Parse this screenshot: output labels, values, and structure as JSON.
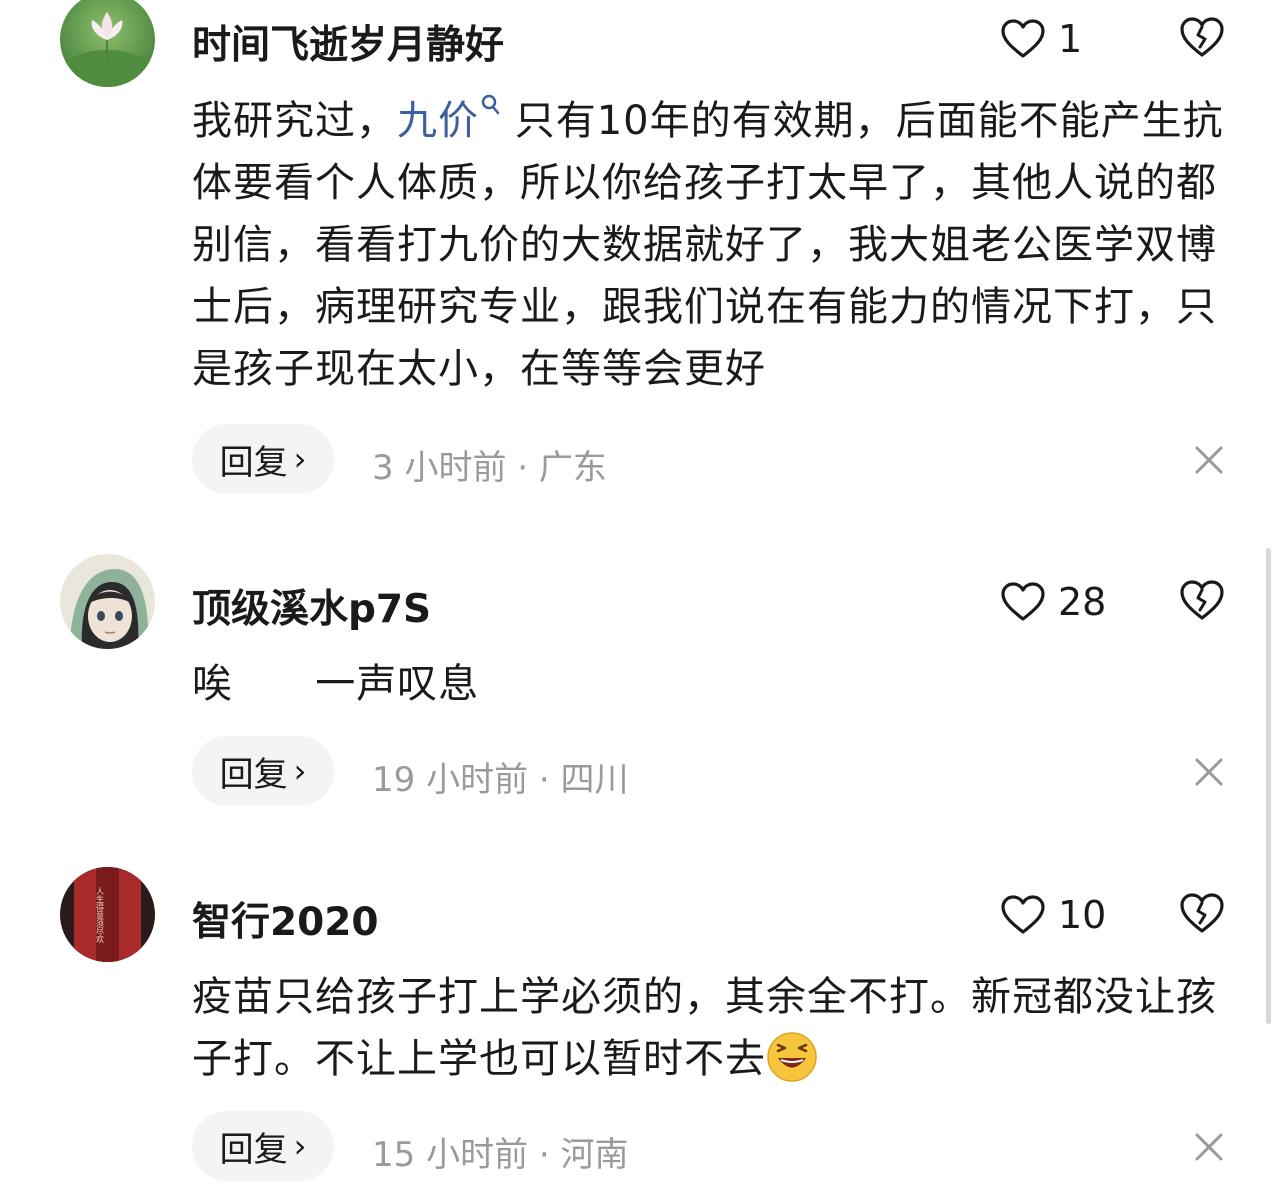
{
  "comments": [
    {
      "username": "时间飞逝岁月静好",
      "like_count": "1",
      "text_before_link": "我研究过，",
      "link_text": "九价",
      "text_after_link": "只有10年的有效期，后面能不能产生抗体要看个人体质，所以你给孩子打太早了，其他人说的都别信，看看打九价的大数据就好了，我大姐老公医学双博士后，病理研究专业，跟我们说在有能力的情况下打，只是孩子现在太小，在等等会更好",
      "reply_label": "回复",
      "meta": "3 小时前 · 广东"
    },
    {
      "username": "顶级溪水p7S",
      "like_count": "28",
      "text": "唉      一声叹息",
      "reply_label": "回复",
      "meta": "19 小时前 · 四川"
    },
    {
      "username": "智行2020",
      "like_count": "10",
      "text": "疫苗只给孩子打上学必须的，其余全不打。新冠都没让孩子打。不让上学也可以暂时不去",
      "reply_label": "回复",
      "meta": "15 小时前 · 河南",
      "avatar_text": "人生得意须尽欢"
    }
  ],
  "colors": {
    "link": "#3d5f9e",
    "meta": "#9a9a9a",
    "reply_bg": "#f4f4f5"
  },
  "icons": {
    "like": "heart-outline-icon",
    "dislike": "broken-heart-icon",
    "close": "close-icon",
    "search": "search-icon",
    "emoji": "laughing-emoji-icon"
  }
}
